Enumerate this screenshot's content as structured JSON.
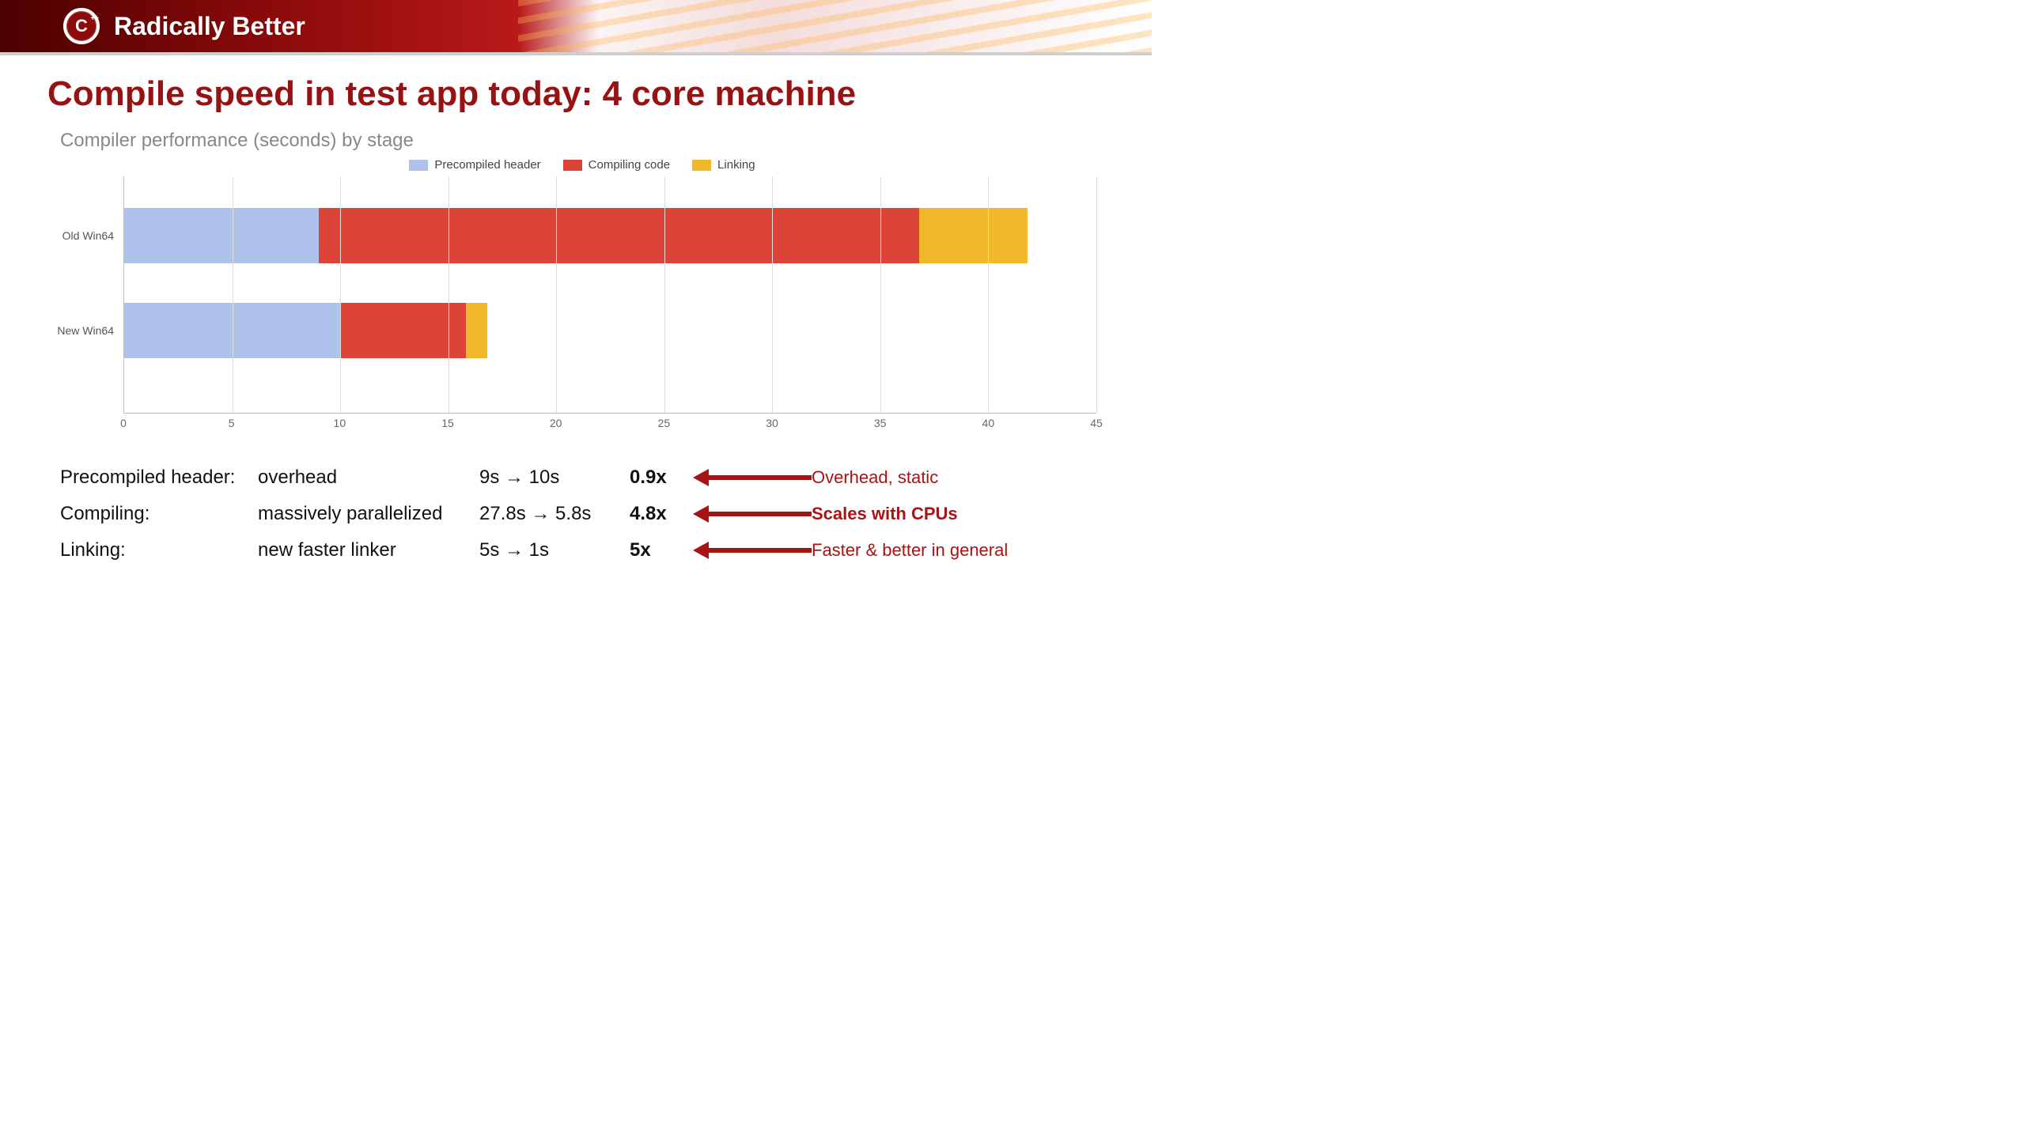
{
  "header": {
    "logo_letter": "C",
    "logo_plus": "++",
    "title": "Radically Better"
  },
  "main_title": "Compile speed in test app today: 4 core machine",
  "chart_subtitle": "Compiler performance (seconds) by stage",
  "legend": {
    "precompiled": "Precompiled header",
    "compiling": "Compiling code",
    "linking": "Linking"
  },
  "categories": [
    "Old Win64",
    "New Win64"
  ],
  "xticks": [
    "0",
    "5",
    "10",
    "15",
    "20",
    "25",
    "30",
    "35",
    "40",
    "45"
  ],
  "summary": [
    {
      "stage": "Precompiled header:",
      "desc": "overhead",
      "change": "9s → 10s",
      "factor": "0.9x",
      "note": "Overhead, static",
      "note_strong": false
    },
    {
      "stage": "Compiling:",
      "desc": "massively parallelized",
      "change": "27.8s → 5.8s",
      "factor": "4.8x",
      "note": "Scales with CPUs",
      "note_strong": true
    },
    {
      "stage": "Linking:",
      "desc": "new faster linker",
      "change": "5s → 1s",
      "factor": "5x",
      "note": "Faster & better in general",
      "note_strong": false
    }
  ],
  "colors": {
    "precompiled": "#aec2eb",
    "compiling": "#db4437",
    "linking": "#f1b82c",
    "accent": "#971212"
  },
  "chart_data": {
    "type": "bar",
    "orientation": "horizontal-stacked",
    "title": "Compiler performance (seconds) by stage",
    "xlabel": "",
    "ylabel": "",
    "xlim": [
      0,
      45
    ],
    "categories": [
      "Old Win64",
      "New Win64"
    ],
    "series": [
      {
        "name": "Precompiled header",
        "values": [
          9.0,
          10.0
        ]
      },
      {
        "name": "Compiling code",
        "values": [
          27.8,
          5.8
        ]
      },
      {
        "name": "Linking",
        "values": [
          5.0,
          1.0
        ]
      }
    ]
  }
}
